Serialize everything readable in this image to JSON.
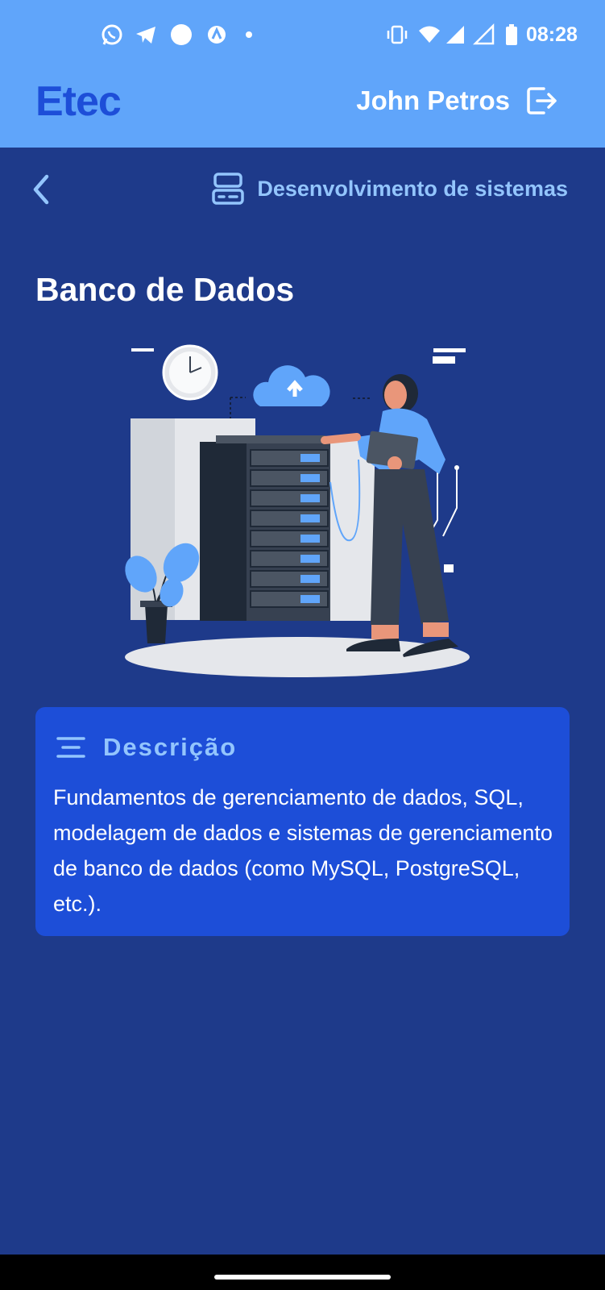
{
  "status_bar": {
    "time": "08:28",
    "left_icons": [
      "whatsapp-icon",
      "telegram-icon",
      "circle-icon",
      "app-icon",
      "dot-icon"
    ],
    "right_icons": [
      "vibrate-icon",
      "wifi-icon",
      "signal-icon",
      "signal-empty-icon",
      "battery-icon"
    ]
  },
  "header": {
    "logo": "Etec",
    "user_name": "John Petros",
    "logout_icon": "logout-icon"
  },
  "nav": {
    "back_icon": "chevron-left-icon",
    "course_icon": "server-icon",
    "course_name": "Desenvolvimento de sistemas"
  },
  "page": {
    "title": "Banco de Dados",
    "illustration": "database-server-illustration"
  },
  "description": {
    "icon": "align-center-icon",
    "title": "Descrição",
    "text": "Fundamentos de gerenciamento de dados, SQL, modelagem de dados e sistemas de gerenciamento de banco de dados (como MySQL, PostgreSQL, etc.)."
  },
  "colors": {
    "header": "#60a5fa",
    "background": "#1e3a8a",
    "card": "#1d4ed8",
    "accent": "#93c5fd",
    "logo": "#1d4ed8"
  }
}
